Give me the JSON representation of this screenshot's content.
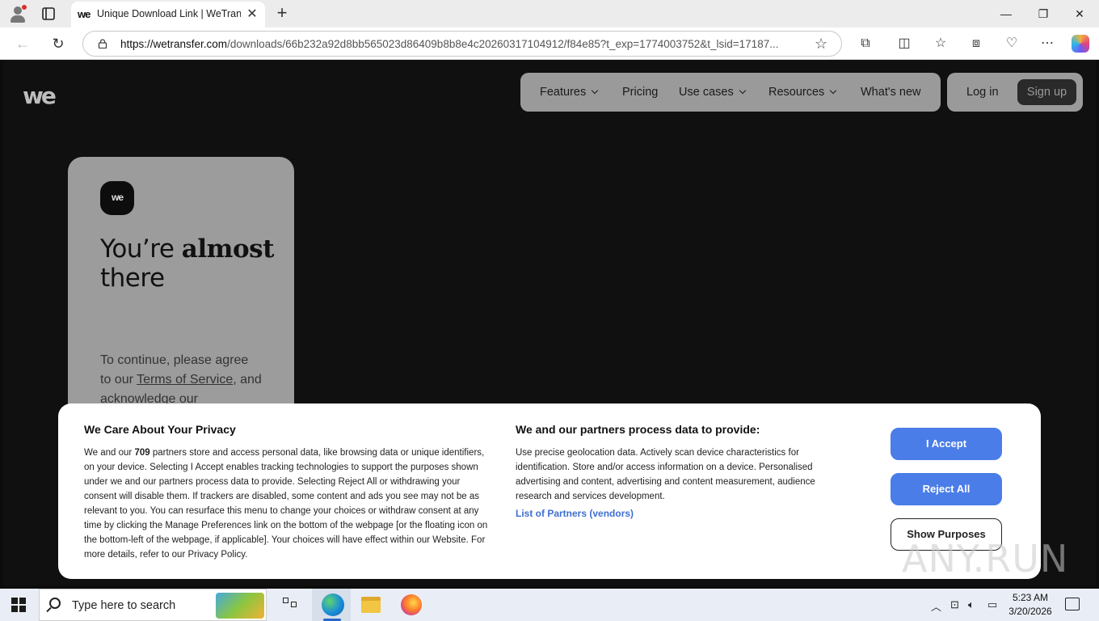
{
  "browser": {
    "tab_title": "Unique Download Link | WeTransfer",
    "tab_favicon": "we",
    "url_host": "https://wetransfer.com",
    "url_path": "/downloads/66b232a92d8bb565023d86409b8b8e4c20260317104912/f84e85?t_exp=1774003752&t_lsid=17187..."
  },
  "site": {
    "logo": "we",
    "nav": {
      "features": "Features",
      "pricing": "Pricing",
      "use_cases": "Use cases",
      "resources": "Resources",
      "whats_new": "What's new"
    },
    "login": "Log in",
    "signup": "Sign up",
    "card": {
      "logo": "we",
      "heading_pre": "You’re ",
      "heading_bold": "almost",
      "heading_post": "there",
      "para_1": "To continue, please agree to our ",
      "tos": "Terms of Service",
      "para_2": ", and acknowledge our"
    }
  },
  "consent": {
    "title_left": "We Care About Your Privacy",
    "body_pre": "We and our ",
    "partner_count": "709",
    "body_post": " partners store and access personal data, like browsing data or unique identifiers, on your device. Selecting I Accept enables tracking technologies to support the purposes shown under we and our partners process data to provide. Selecting Reject All or withdrawing your consent will disable them. If trackers are disabled, some content and ads you see may not be as relevant to you. You can resurface this menu to change your choices or withdraw consent at any time by clicking the Manage Preferences link on the bottom of the webpage [or the floating icon on the bottom-left of the webpage, if applicable]. Your choices will have effect within our Website. For more details, refer to our Privacy Policy.",
    "title_right": "We and our partners process data to provide:",
    "body_right": "Use precise geolocation data. Actively scan device characteristics for identification. Store and/or access information on a device. Personalised advertising and content, advertising and content measurement, audience research and services development.",
    "partners_link": "List of Partners (vendors)",
    "accept": "I Accept",
    "reject": "Reject All",
    "show_purposes": "Show Purposes"
  },
  "watermark": "ANY.RUN",
  "taskbar": {
    "search_placeholder": "Type here to search",
    "time": "5:23 AM",
    "date": "3/20/2026"
  },
  "colors": {
    "accent_blue": "#4a7de8",
    "link_blue": "#3f6fd0",
    "page_bg": "#101010"
  }
}
